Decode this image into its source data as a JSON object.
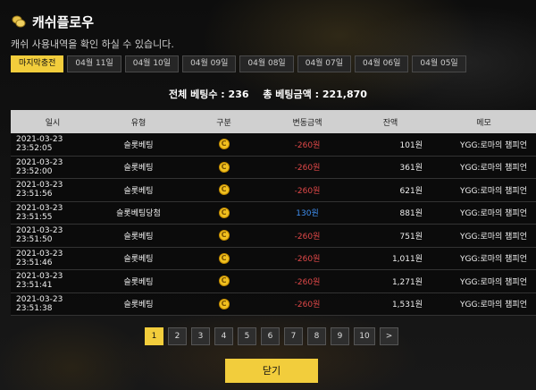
{
  "header": {
    "title": "캐쉬플로우",
    "subtitle": "캐쉬 사용내역을 확인 하실 수 있습니다."
  },
  "tabs": [
    "마지막충전",
    "04월 11일",
    "04월 10일",
    "04월 09일",
    "04월 08일",
    "04월 07일",
    "04월 06일",
    "04월 05일"
  ],
  "summary": {
    "total_count_label": "전체 베팅수 : 236",
    "total_amount_label": "총 베팅금액 : 221,870"
  },
  "table": {
    "headers": [
      "일시",
      "유형",
      "구분",
      "변동금액",
      "잔액",
      "메모"
    ],
    "rows": [
      {
        "date": "2021-03-23 23:52:05",
        "type": "슬롯베팅",
        "icon": "C",
        "change": "-260원",
        "balance": "101원",
        "memo": "YGG:로마의 챔피언"
      },
      {
        "date": "2021-03-23 23:52:00",
        "type": "슬롯베팅",
        "icon": "C",
        "change": "-260원",
        "balance": "361원",
        "memo": "YGG:로마의 챔피언"
      },
      {
        "date": "2021-03-23 23:51:56",
        "type": "슬롯베팅",
        "icon": "C",
        "change": "-260원",
        "balance": "621원",
        "memo": "YGG:로마의 챔피언"
      },
      {
        "date": "2021-03-23 23:51:55",
        "type": "슬롯베팅당첨",
        "icon": "C",
        "change": "130원",
        "balance": "881원",
        "memo": "YGG:로마의 챔피언"
      },
      {
        "date": "2021-03-23 23:51:50",
        "type": "슬롯베팅",
        "icon": "C",
        "change": "-260원",
        "balance": "751원",
        "memo": "YGG:로마의 챔피언"
      },
      {
        "date": "2021-03-23 23:51:46",
        "type": "슬롯베팅",
        "icon": "C",
        "change": "-260원",
        "balance": "1,011원",
        "memo": "YGG:로마의 챔피언"
      },
      {
        "date": "2021-03-23 23:51:41",
        "type": "슬롯베팅",
        "icon": "C",
        "change": "-260원",
        "balance": "1,271원",
        "memo": "YGG:로마의 챔피언"
      },
      {
        "date": "2021-03-23 23:51:38",
        "type": "슬롯베팅",
        "icon": "C",
        "change": "-260원",
        "balance": "1,531원",
        "memo": "YGG:로마의 챔피언"
      }
    ]
  },
  "pagination": {
    "pages": [
      "1",
      "2",
      "3",
      "4",
      "5",
      "6",
      "7",
      "8",
      "9",
      "10"
    ],
    "next": ">"
  },
  "close_label": "닫기",
  "colors": {
    "accent": "#f2cd3c",
    "negative": "#e04848",
    "positive": "#3f8ff0",
    "coin": "#f0c020"
  }
}
